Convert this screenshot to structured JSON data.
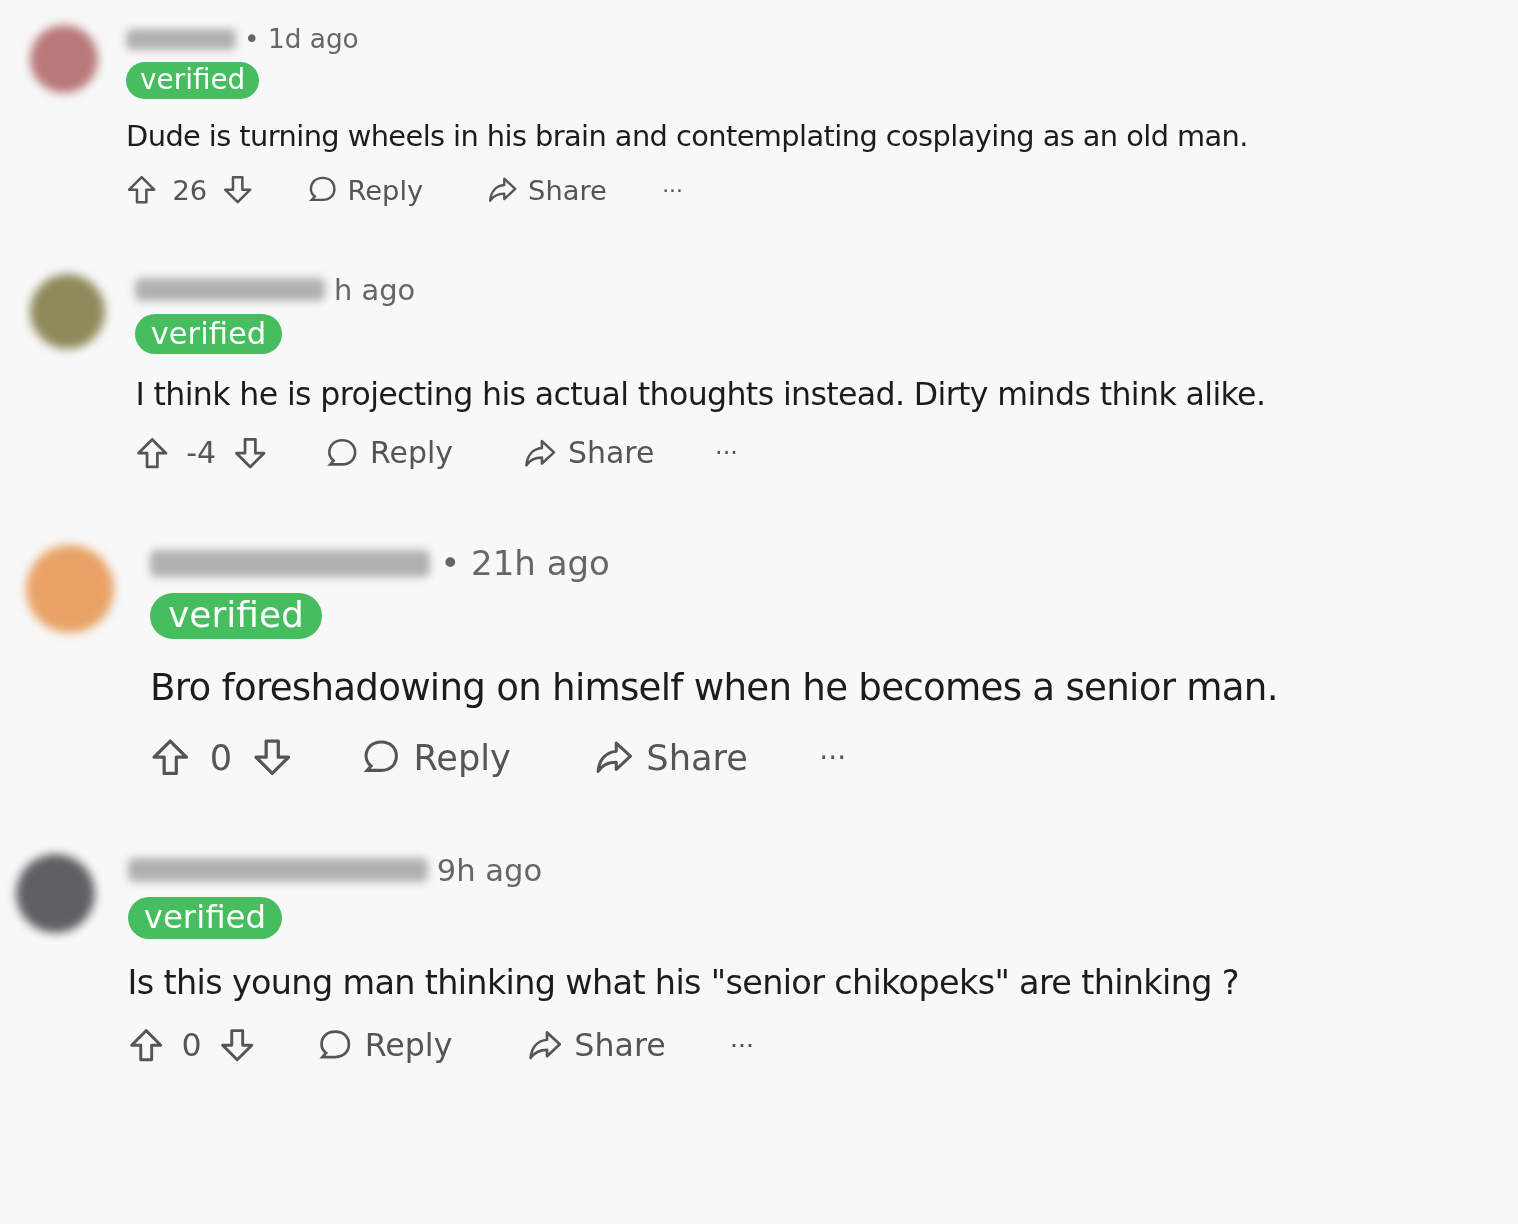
{
  "comments": [
    {
      "avatar": {
        "color": "#b9787a"
      },
      "time": "• 1d ago",
      "badge": "verified",
      "text": "Dude is turning wheels in his brain and contemplating cosplaying as an old man.",
      "score": "26",
      "reply": "Reply",
      "share": "Share",
      "more": "···"
    },
    {
      "avatar": {
        "color": "#8f8a5a"
      },
      "time": "h ago",
      "badge": "verified",
      "text": "I think he is projecting his actual thoughts instead. Dirty minds think alike.",
      "score": "-4",
      "reply": "Reply",
      "share": "Share",
      "more": "···"
    },
    {
      "avatar": {
        "color": "#e9a266"
      },
      "time": "• 21h ago",
      "badge": "verified",
      "text": "Bro foreshadowing on himself when he becomes a senior man.",
      "score": "0",
      "reply": "Reply",
      "share": "Share",
      "more": "···"
    },
    {
      "avatar": {
        "color": "#5d6163"
      },
      "time": "9h ago",
      "badge": "verified",
      "text": "Is this young man thinking what his \"senior chikopeks\" are thinking ?",
      "score": "0",
      "reply": "Reply",
      "share": "Share",
      "more": "···"
    }
  ]
}
